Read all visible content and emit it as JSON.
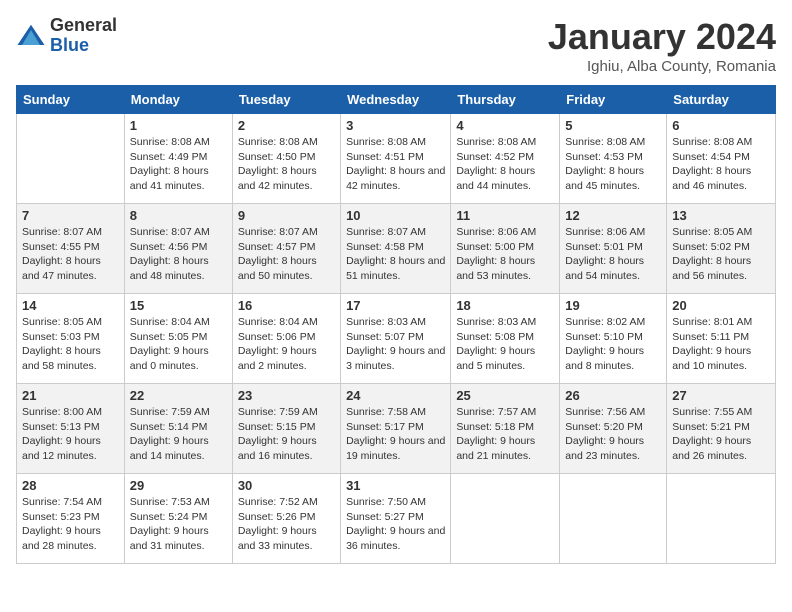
{
  "header": {
    "logo_general": "General",
    "logo_blue": "Blue",
    "title": "January 2024",
    "subtitle": "Ighiu, Alba County, Romania"
  },
  "days_of_week": [
    "Sunday",
    "Monday",
    "Tuesday",
    "Wednesday",
    "Thursday",
    "Friday",
    "Saturday"
  ],
  "weeks": [
    [
      {
        "day": "",
        "empty": true
      },
      {
        "day": "1",
        "sunrise": "8:08 AM",
        "sunset": "4:49 PM",
        "daylight": "8 hours and 41 minutes."
      },
      {
        "day": "2",
        "sunrise": "8:08 AM",
        "sunset": "4:50 PM",
        "daylight": "8 hours and 42 minutes."
      },
      {
        "day": "3",
        "sunrise": "8:08 AM",
        "sunset": "4:51 PM",
        "daylight": "8 hours and 42 minutes."
      },
      {
        "day": "4",
        "sunrise": "8:08 AM",
        "sunset": "4:52 PM",
        "daylight": "8 hours and 44 minutes."
      },
      {
        "day": "5",
        "sunrise": "8:08 AM",
        "sunset": "4:53 PM",
        "daylight": "8 hours and 45 minutes."
      },
      {
        "day": "6",
        "sunrise": "8:08 AM",
        "sunset": "4:54 PM",
        "daylight": "8 hours and 46 minutes."
      }
    ],
    [
      {
        "day": "7",
        "sunrise": "8:07 AM",
        "sunset": "4:55 PM",
        "daylight": "8 hours and 47 minutes."
      },
      {
        "day": "8",
        "sunrise": "8:07 AM",
        "sunset": "4:56 PM",
        "daylight": "8 hours and 48 minutes."
      },
      {
        "day": "9",
        "sunrise": "8:07 AM",
        "sunset": "4:57 PM",
        "daylight": "8 hours and 50 minutes."
      },
      {
        "day": "10",
        "sunrise": "8:07 AM",
        "sunset": "4:58 PM",
        "daylight": "8 hours and 51 minutes."
      },
      {
        "day": "11",
        "sunrise": "8:06 AM",
        "sunset": "5:00 PM",
        "daylight": "8 hours and 53 minutes."
      },
      {
        "day": "12",
        "sunrise": "8:06 AM",
        "sunset": "5:01 PM",
        "daylight": "8 hours and 54 minutes."
      },
      {
        "day": "13",
        "sunrise": "8:05 AM",
        "sunset": "5:02 PM",
        "daylight": "8 hours and 56 minutes."
      }
    ],
    [
      {
        "day": "14",
        "sunrise": "8:05 AM",
        "sunset": "5:03 PM",
        "daylight": "8 hours and 58 minutes."
      },
      {
        "day": "15",
        "sunrise": "8:04 AM",
        "sunset": "5:05 PM",
        "daylight": "9 hours and 0 minutes."
      },
      {
        "day": "16",
        "sunrise": "8:04 AM",
        "sunset": "5:06 PM",
        "daylight": "9 hours and 2 minutes."
      },
      {
        "day": "17",
        "sunrise": "8:03 AM",
        "sunset": "5:07 PM",
        "daylight": "9 hours and 3 minutes."
      },
      {
        "day": "18",
        "sunrise": "8:03 AM",
        "sunset": "5:08 PM",
        "daylight": "9 hours and 5 minutes."
      },
      {
        "day": "19",
        "sunrise": "8:02 AM",
        "sunset": "5:10 PM",
        "daylight": "9 hours and 8 minutes."
      },
      {
        "day": "20",
        "sunrise": "8:01 AM",
        "sunset": "5:11 PM",
        "daylight": "9 hours and 10 minutes."
      }
    ],
    [
      {
        "day": "21",
        "sunrise": "8:00 AM",
        "sunset": "5:13 PM",
        "daylight": "9 hours and 12 minutes."
      },
      {
        "day": "22",
        "sunrise": "7:59 AM",
        "sunset": "5:14 PM",
        "daylight": "9 hours and 14 minutes."
      },
      {
        "day": "23",
        "sunrise": "7:59 AM",
        "sunset": "5:15 PM",
        "daylight": "9 hours and 16 minutes."
      },
      {
        "day": "24",
        "sunrise": "7:58 AM",
        "sunset": "5:17 PM",
        "daylight": "9 hours and 19 minutes."
      },
      {
        "day": "25",
        "sunrise": "7:57 AM",
        "sunset": "5:18 PM",
        "daylight": "9 hours and 21 minutes."
      },
      {
        "day": "26",
        "sunrise": "7:56 AM",
        "sunset": "5:20 PM",
        "daylight": "9 hours and 23 minutes."
      },
      {
        "day": "27",
        "sunrise": "7:55 AM",
        "sunset": "5:21 PM",
        "daylight": "9 hours and 26 minutes."
      }
    ],
    [
      {
        "day": "28",
        "sunrise": "7:54 AM",
        "sunset": "5:23 PM",
        "daylight": "9 hours and 28 minutes."
      },
      {
        "day": "29",
        "sunrise": "7:53 AM",
        "sunset": "5:24 PM",
        "daylight": "9 hours and 31 minutes."
      },
      {
        "day": "30",
        "sunrise": "7:52 AM",
        "sunset": "5:26 PM",
        "daylight": "9 hours and 33 minutes."
      },
      {
        "day": "31",
        "sunrise": "7:50 AM",
        "sunset": "5:27 PM",
        "daylight": "9 hours and 36 minutes."
      },
      {
        "day": "",
        "empty": true
      },
      {
        "day": "",
        "empty": true
      },
      {
        "day": "",
        "empty": true
      }
    ]
  ],
  "labels": {
    "sunrise": "Sunrise: ",
    "sunset": "Sunset: ",
    "daylight": "Daylight: "
  }
}
